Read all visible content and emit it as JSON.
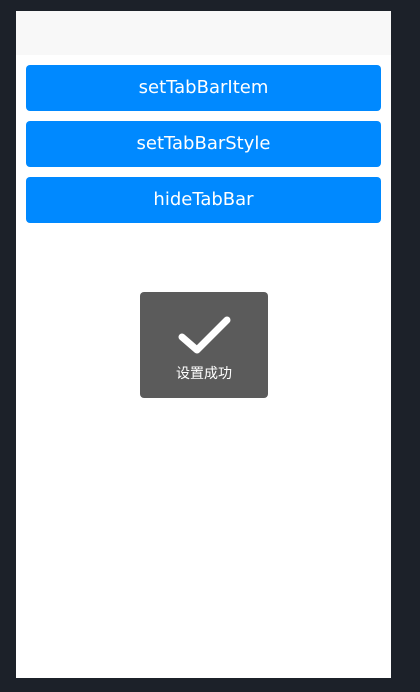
{
  "buttons": {
    "set_tab_bar_item": "setTabBarItem",
    "set_tab_bar_style": "setTabBarStyle",
    "hide_tab_bar": "hideTabBar"
  },
  "toast": {
    "icon": "checkmark-icon",
    "message": "设置成功"
  },
  "colors": {
    "background": "#1c2129",
    "nav_bar": "#f8f8f8",
    "button": "#0089ff",
    "toast": "#5b5b5b"
  }
}
